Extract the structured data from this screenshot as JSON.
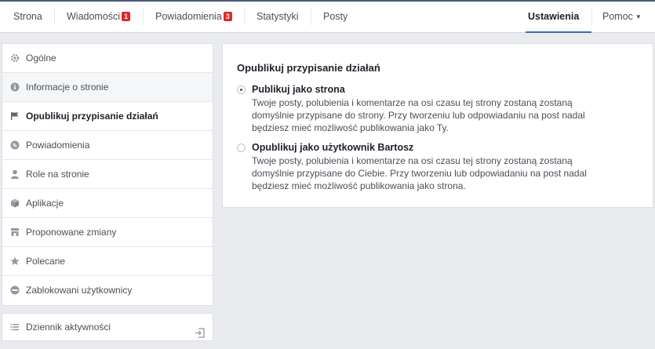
{
  "nav": {
    "tabs": [
      {
        "label": "Strona"
      },
      {
        "label": "Wiadomości",
        "badge": "1"
      },
      {
        "label": "Powiadomienia",
        "badge": "3"
      },
      {
        "label": "Statystyki"
      },
      {
        "label": "Posty"
      }
    ],
    "settings_label": "Ustawienia",
    "help_label": "Pomoc"
  },
  "sidebar": {
    "items": [
      {
        "label": "Ogólne",
        "icon": "gear-icon"
      },
      {
        "label": "Informacje o stronie",
        "icon": "info-icon"
      },
      {
        "label": "Opublikuj przypisanie działań",
        "icon": "flag-icon"
      },
      {
        "label": "Powiadomienia",
        "icon": "globe-icon"
      },
      {
        "label": "Role na stronie",
        "icon": "person-icon"
      },
      {
        "label": "Aplikacje",
        "icon": "cube-icon"
      },
      {
        "label": "Proponowane zmiany",
        "icon": "store-icon"
      },
      {
        "label": "Polecane",
        "icon": "star-icon"
      },
      {
        "label": "Zablokowani użytkownicy",
        "icon": "blocked-icon"
      }
    ],
    "activity_log": "Dziennik aktywności"
  },
  "panel": {
    "title": "Opublikuj przypisanie działań",
    "options": [
      {
        "label": "Publikuj jako strona",
        "checked": true,
        "description": "Twoje posty, polubienia i komentarze na osi czasu tej strony zostaną zostaną domyślnie przypisane do strony. Przy tworzeniu lub odpowiadaniu na post nadal będziesz mieć możliwość publikowania jako Ty."
      },
      {
        "label": "Opublikuj jako użytkownik Bartosz",
        "checked": false,
        "description": "Twoje posty, polubienia i komentarze na osi czasu tej strony zostaną zostaną domyślnie przypisane do Ciebie. Przy tworzeniu lub odpowiadaniu na post nadal będziesz mieć możliwość publikowania jako strona."
      }
    ]
  }
}
